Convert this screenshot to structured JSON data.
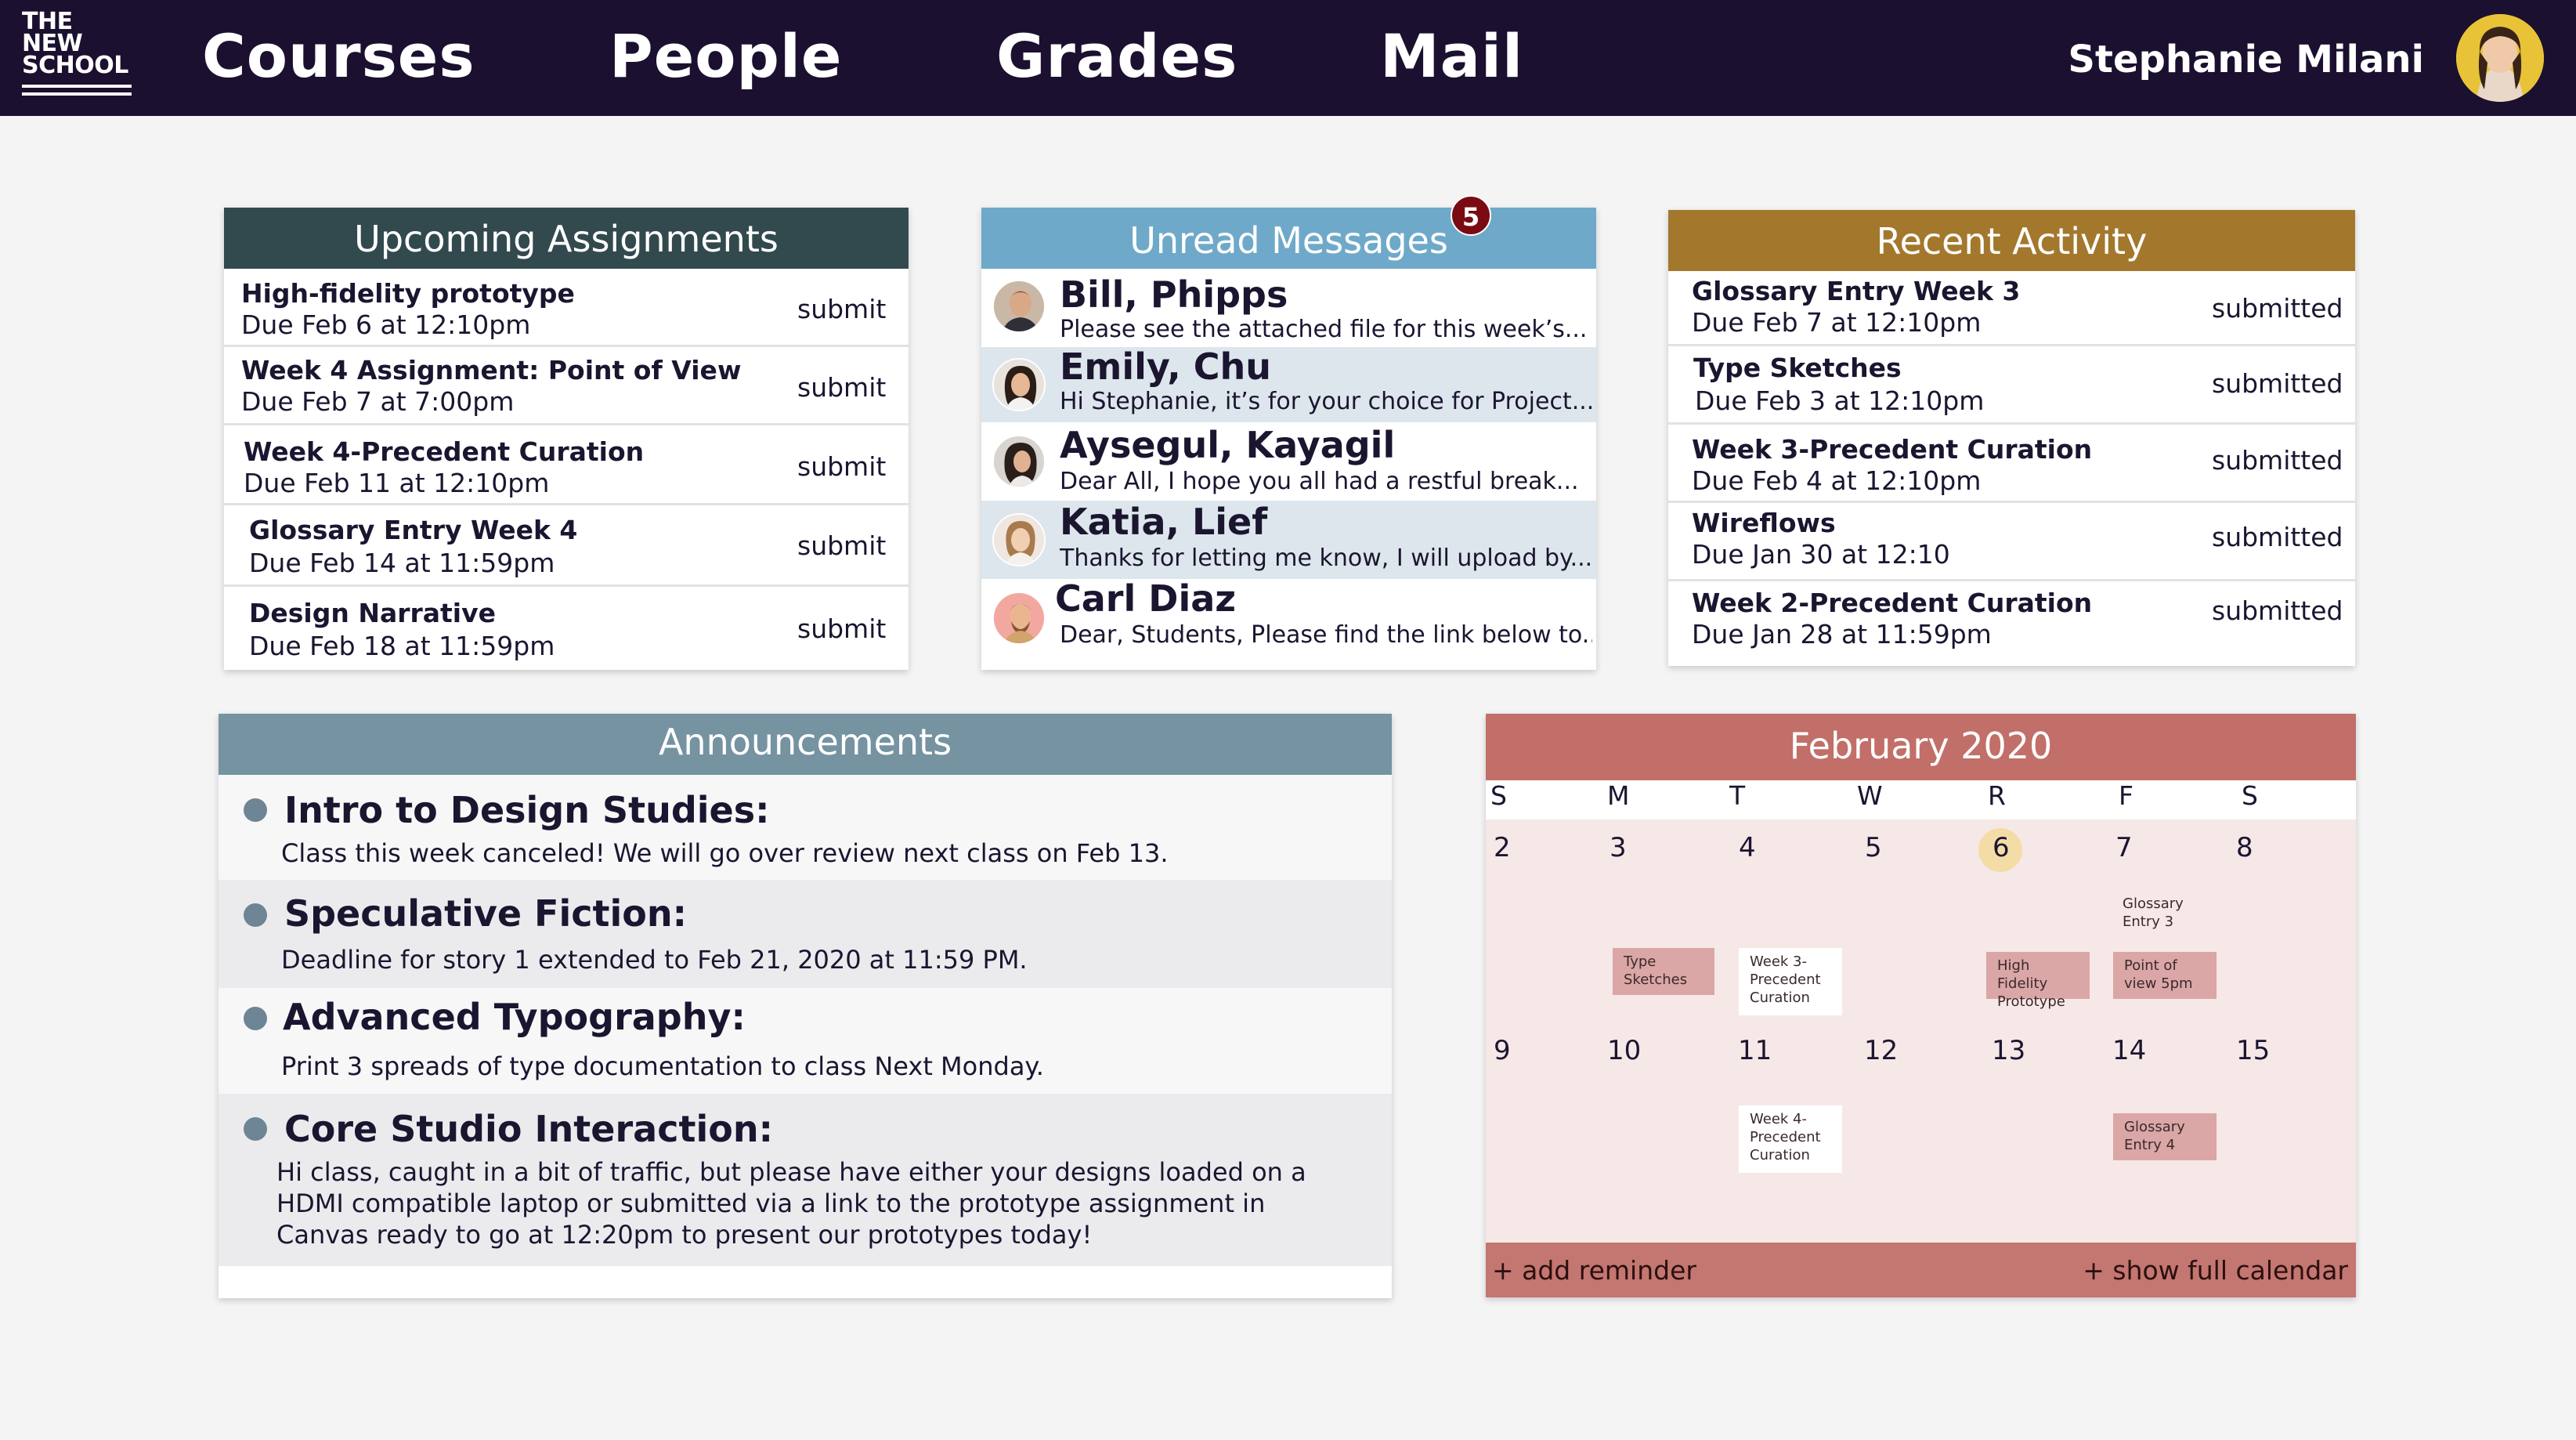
{
  "logo": {
    "lines": [
      "THE",
      "NEW",
      "SCHOOL"
    ]
  },
  "nav": {
    "courses": "Courses",
    "people": "People",
    "grades": "Grades",
    "mail": "Mail"
  },
  "user": {
    "name": "Stephanie Milani"
  },
  "upcoming": {
    "title": "Upcoming Assignments",
    "header_color": "#324a4d",
    "items": [
      {
        "title": "High-fidelity prototype",
        "due": "Due Feb 6 at 12:10pm",
        "action": "submit"
      },
      {
        "title": "Week 4 Assignment: Point of View",
        "due": "Due Feb 7 at 7:00pm",
        "action": "submit"
      },
      {
        "title": "Week 4-Precedent Curation",
        "due": "Due Feb 11 at 12:10pm",
        "action": "submit"
      },
      {
        "title": "Glossary Entry Week 4",
        "due": "Due Feb 14 at 11:59pm",
        "action": "submit"
      },
      {
        "title": "Design Narrative",
        "due": "Due Feb 18 at 11:59pm",
        "action": "submit"
      }
    ]
  },
  "messages": {
    "title": "Unread Messages",
    "header_color": "#6fa9c9",
    "badge": "5",
    "items": [
      {
        "name": "Bill, Phipps",
        "preview": "Please see the attached file for this week’s..."
      },
      {
        "name": "Emily, Chu",
        "preview": "Hi Stephanie, it’s for your choice for Project..."
      },
      {
        "name": "Aysegul, Kayagil",
        "preview": "Dear All, I hope you all had a restful break..."
      },
      {
        "name": "Katia, Lief",
        "preview": "Thanks for letting me know, I will upload by..."
      },
      {
        "name": "Carl Diaz",
        "preview": "Dear, Students, Please find the link below to..."
      }
    ]
  },
  "activity": {
    "title": "Recent Activity",
    "header_color": "#a3782d",
    "items": [
      {
        "title": "Glossary Entry Week 3",
        "due": "Due Feb 7 at 12:10pm",
        "status": "submitted"
      },
      {
        "title": "Type Sketches",
        "due": "Due Feb 3 at 12:10pm",
        "status": "submitted"
      },
      {
        "title": "Week 3-Precedent Curation",
        "due": "Due Feb 4 at 12:10pm",
        "status": "submitted"
      },
      {
        "title": "Wireflows",
        "due": "Due Jan 30 at 12:10",
        "status": "submitted"
      },
      {
        "title": "Week 2-Precedent Curation",
        "due": "Due Jan 28 at 11:59pm",
        "status": "submitted"
      }
    ]
  },
  "announcements": {
    "title": "Announcements",
    "header_color": "#7593a1",
    "items": [
      {
        "title": "Intro to Design Studies:",
        "body": "Class this week canceled! We will go over review next class on Feb 13."
      },
      {
        "title": "Speculative Fiction:",
        "body": "Deadline for story 1 extended to Feb 21, 2020 at 11:59 PM."
      },
      {
        "title": "Advanced Typography:",
        "body": "Print 3 spreads of type documentation to class Next Monday."
      },
      {
        "title": "Core Studio Interaction:",
        "body": "Hi class, caught in a bit of traffic, but please have either your designs loaded on a HDMI compatible laptop or submitted via a link to the prototype assignment in Canvas ready to go at 12:20pm to present our prototypes today!"
      }
    ]
  },
  "calendar": {
    "title": "February 2020",
    "header_color": "#c16f68",
    "weekdays": [
      "S",
      "M",
      "T",
      "W",
      "R",
      "F",
      "S"
    ],
    "week1": [
      "2",
      "3",
      "4",
      "5",
      "6",
      "7",
      "8"
    ],
    "week2": [
      "9",
      "10",
      "11",
      "12",
      "13",
      "14",
      "15"
    ],
    "today": "6",
    "events": {
      "type_sketches": "Type Sketches",
      "week3_precedent": "Week 3- Precedent Curation",
      "high_fidelity": "High Fidelity Prototype",
      "point_of_view": "Point of view 5pm",
      "glossary3": "Glossary Entry 3",
      "week4_precedent": "Week 4- Precedent Curation",
      "glossary4": "Glossary Entry 4"
    },
    "add_reminder": "+ add reminder",
    "show_full": "+ show full calendar"
  }
}
